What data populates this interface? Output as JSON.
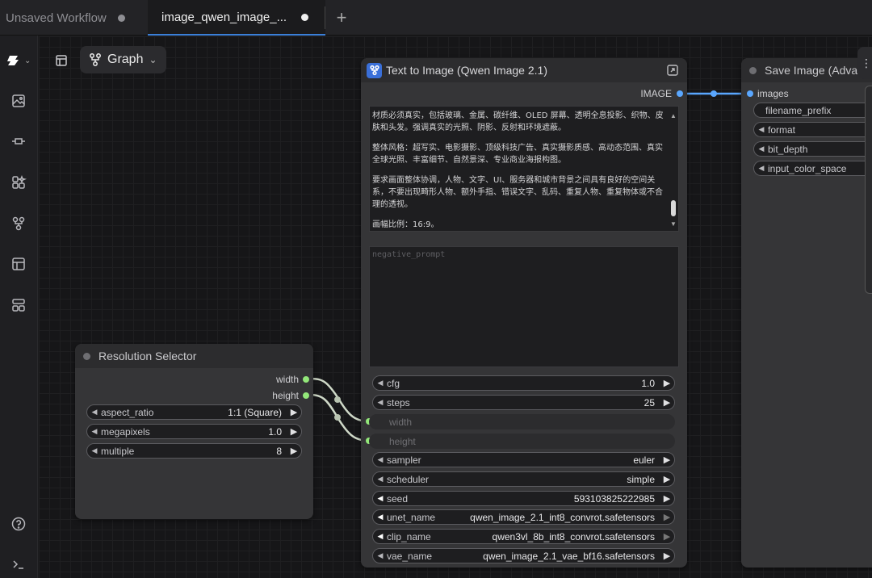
{
  "tabs": [
    {
      "label": "Unsaved Workflow",
      "active": false
    },
    {
      "label": "image_qwen_image_...",
      "active": true
    }
  ],
  "tab_add_label": "+",
  "toolbar": {
    "graph_label": "Graph"
  },
  "sidebar_icons": [
    "comfy-logo-icon",
    "image-gallery-icon",
    "node-link-icon",
    "model-library-icon",
    "workflows-icon",
    "templates-icon",
    "layers-icon",
    "help-icon",
    "terminal-icon"
  ],
  "nodes": {
    "resolution_selector": {
      "title": "Resolution Selector",
      "outputs": [
        "width",
        "height"
      ],
      "widgets": [
        {
          "label": "aspect_ratio",
          "value": "1:1 (Square)"
        },
        {
          "label": "megapixels",
          "value": "1.0"
        },
        {
          "label": "multiple",
          "value": "8"
        }
      ]
    },
    "text_to_image": {
      "title": "Text to Image (Qwen Image 2.1)",
      "output": "IMAGE",
      "prompt_paragraphs": [
        "材质必须真实，包括玻璃、金属、碳纤维、OLED 屏幕、透明全息投影、织物、皮肤和头发。强调真实的光照、阴影、反射和环境遮蔽。",
        "整体风格：超写实、电影摄影、顶级科技广告、真实摄影质感、高动态范围、真实全球光照、丰富细节、自然景深、专业商业海报构图。",
        "要求画面整体协调，人物、文字、UI、服务器和城市背景之间具有良好的空间关系，不要出现畸形人物、额外手指、错误文字、乱码、重复人物、重复物体或不合理的透视。",
        "画幅比例：16:9。"
      ],
      "negative_placeholder": "negative_prompt",
      "widgets": [
        {
          "label": "cfg",
          "value": "1.0"
        },
        {
          "label": "steps",
          "value": "25"
        }
      ],
      "linked_inputs": [
        "width",
        "height"
      ],
      "widgets2": [
        {
          "label": "sampler",
          "value": "euler"
        },
        {
          "label": "scheduler",
          "value": "simple"
        },
        {
          "label": "seed",
          "value": "593103825222985"
        },
        {
          "label": "unet_name",
          "value": "qwen_image_2.1_int8_convrot.safetensors"
        },
        {
          "label": "clip_name",
          "value": "qwen3vl_8b_int8_convrot.safetensors"
        },
        {
          "label": "vae_name",
          "value": "qwen_image_2.1_vae_bf16.safetensors"
        }
      ]
    },
    "save_image": {
      "title": "Save Image (Adva",
      "input": "images",
      "widgets": [
        "filename_prefix",
        "format",
        "bit_depth",
        "input_color_space"
      ]
    }
  },
  "colors": {
    "link_green": "#93e87a",
    "link_blue": "#5aa7ff",
    "accent": "#3a6fd8"
  }
}
